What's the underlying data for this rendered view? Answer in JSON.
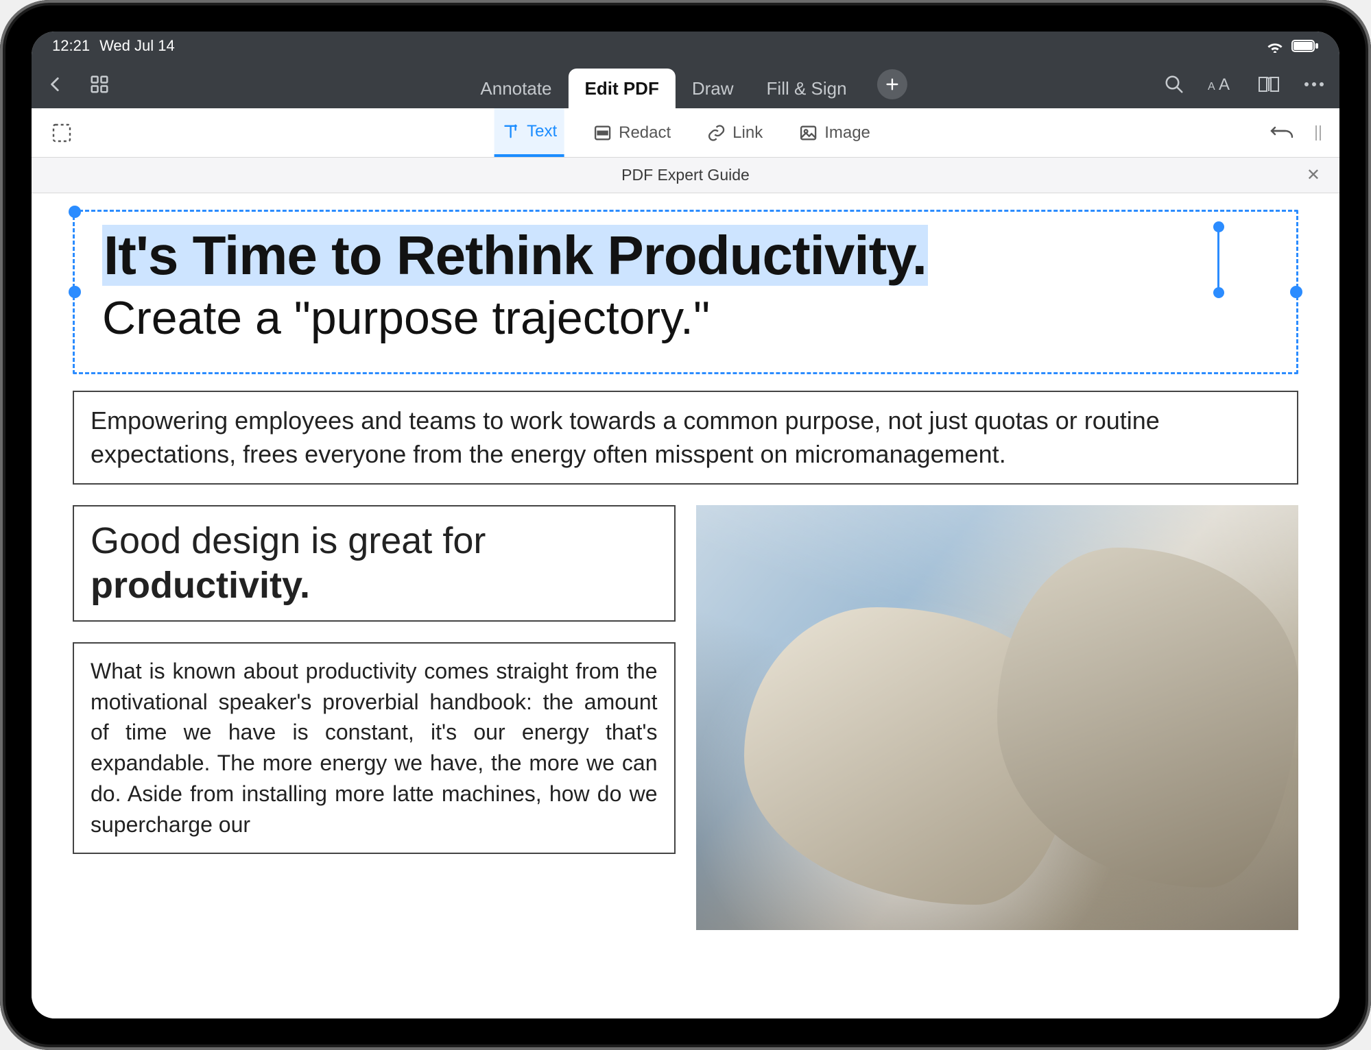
{
  "status": {
    "time": "12:21",
    "date": "Wed Jul 14"
  },
  "toolbar": {
    "tabs": [
      "Annotate",
      "Edit PDF",
      "Draw",
      "Fill & Sign"
    ],
    "active_tab_index": 1
  },
  "edit_tools": {
    "items": [
      "Text",
      "Redact",
      "Link",
      "Image"
    ],
    "active_index": 0
  },
  "file": {
    "title": "PDF Expert Guide"
  },
  "document": {
    "headline": "It's Time to Rethink Productivity.",
    "subhead": "Create a \"purpose trajectory.\"",
    "intro": "Empowering employees and teams to work towards a common purpose, not just quotas or routine expectations, frees everyone from the energy often misspent on micromanagement.",
    "design_lead": "Good design is great for ",
    "design_strong": "productivity.",
    "body": "What is known about productivity comes straight from the motivational speaker's proverbial handbook: the amount of time we have is constant, it's our energy that's expandable. The more energy we have, the more we can do. Aside from installing more latte machines, how do we supercharge our"
  }
}
